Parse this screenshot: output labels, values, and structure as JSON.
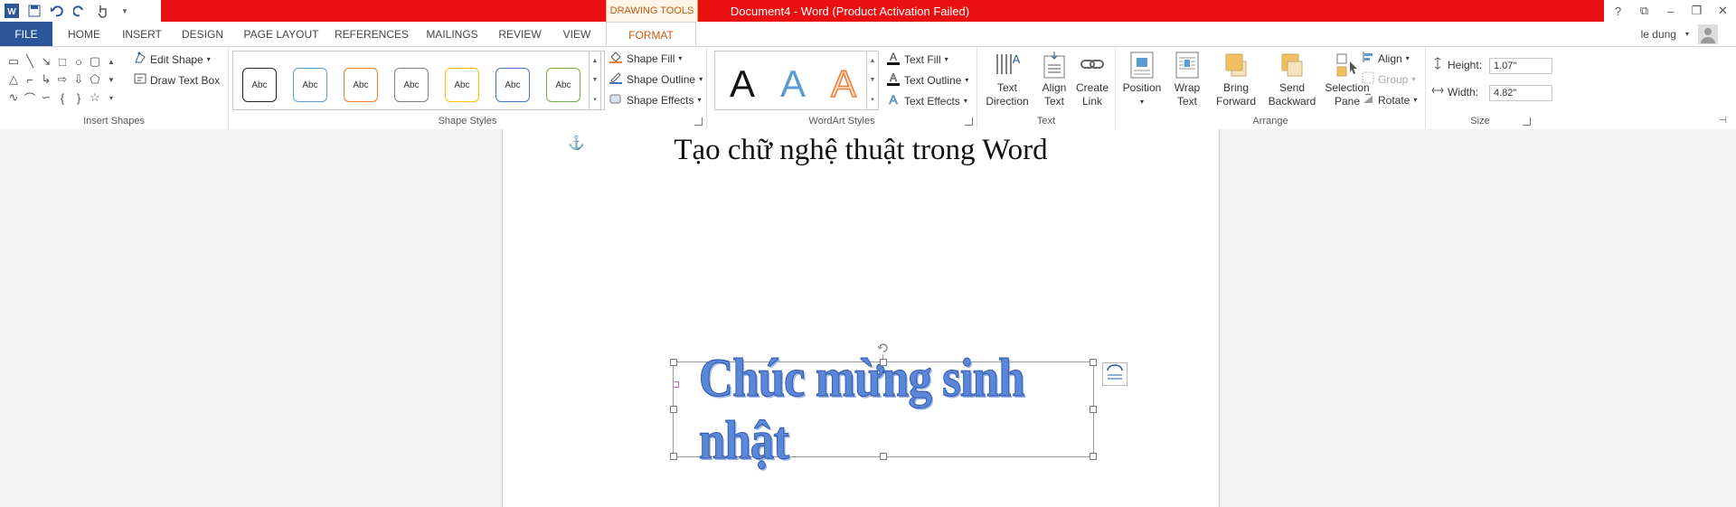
{
  "titlebar": {
    "drawing_tools": "DRAWING TOOLS",
    "document_title": "Document4 -  Word (Product Activation Failed)",
    "help": "?",
    "ribbon_options": "⧉",
    "minimize": "–",
    "restore": "❐",
    "close": "✕",
    "accent": "#e81010"
  },
  "tabs": {
    "file": "FILE",
    "home": "HOME",
    "insert": "INSERT",
    "design": "DESIGN",
    "page_layout": "PAGE LAYOUT",
    "references": "REFERENCES",
    "mailings": "MAILINGS",
    "review": "REVIEW",
    "view": "VIEW",
    "format": "FORMAT"
  },
  "user": {
    "name": "le dung"
  },
  "ribbon": {
    "insert_shapes": {
      "label": "Insert Shapes",
      "edit_shape": "Edit Shape",
      "draw_text_box": "Draw Text Box"
    },
    "shape_styles": {
      "label": "Shape Styles",
      "styles": [
        {
          "text": "Abc",
          "color": "#222222"
        },
        {
          "text": "Abc",
          "color": "#5b9bd5"
        },
        {
          "text": "Abc",
          "color": "#ed7d31"
        },
        {
          "text": "Abc",
          "color": "#7f7f7f"
        },
        {
          "text": "Abc",
          "color": "#ffc000"
        },
        {
          "text": "Abc",
          "color": "#4472c4"
        },
        {
          "text": "Abc",
          "color": "#70ad47"
        }
      ],
      "shape_fill": "Shape Fill",
      "shape_outline": "Shape Outline",
      "shape_effects": "Shape Effects"
    },
    "wordart_styles": {
      "label": "WordArt Styles",
      "samples": [
        "A",
        "A",
        "A"
      ],
      "text_fill": "Text Fill",
      "text_outline": "Text Outline",
      "text_effects": "Text Effects"
    },
    "text": {
      "label": "Text",
      "text_direction_1": "Text",
      "text_direction_2": "Direction",
      "align_text_1": "Align",
      "align_text_2": "Text",
      "create_link_1": "Create",
      "create_link_2": "Link"
    },
    "arrange": {
      "label": "Arrange",
      "position": "Position",
      "wrap_text_1": "Wrap",
      "wrap_text_2": "Text",
      "bring_forward_1": "Bring",
      "bring_forward_2": "Forward",
      "send_backward_1": "Send",
      "send_backward_2": "Backward",
      "selection_pane_1": "Selection",
      "selection_pane_2": "Pane",
      "align": "Align",
      "group": "Group",
      "rotate": "Rotate"
    },
    "size": {
      "label": "Size",
      "height_label": "Height:",
      "height_value": "1.07\"",
      "width_label": "Width:",
      "width_value": "4.82\""
    }
  },
  "document": {
    "heading": "Tạo chữ nghệ thuật trong Word",
    "wordart": "Chúc mừng sinh nhật"
  }
}
